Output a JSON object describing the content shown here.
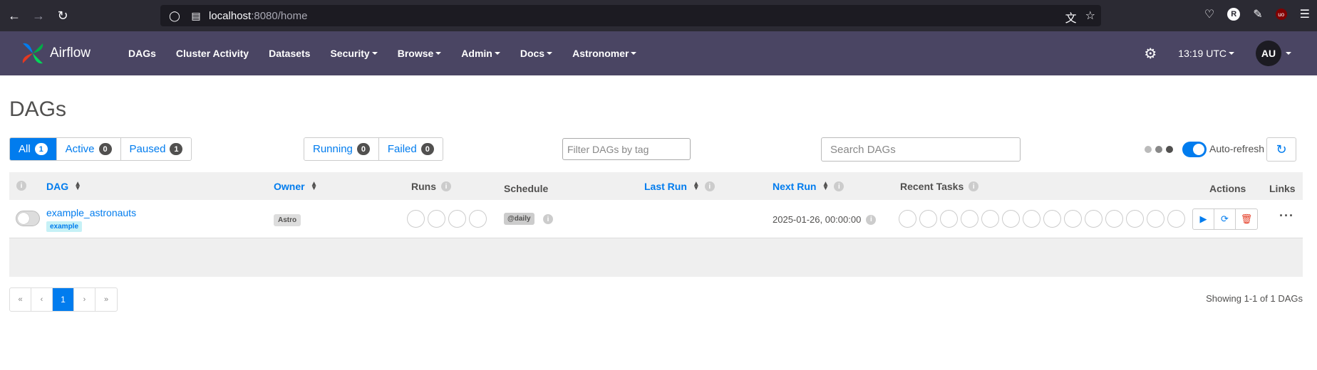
{
  "browser": {
    "url_host": "localhost",
    "url_rest": ":8080/home"
  },
  "navbar": {
    "brand": "Airflow",
    "items": [
      {
        "label": "DAGs",
        "dropdown": false
      },
      {
        "label": "Cluster Activity",
        "dropdown": false
      },
      {
        "label": "Datasets",
        "dropdown": false
      },
      {
        "label": "Security",
        "dropdown": true
      },
      {
        "label": "Browse",
        "dropdown": true
      },
      {
        "label": "Admin",
        "dropdown": true
      },
      {
        "label": "Docs",
        "dropdown": true
      },
      {
        "label": "Astronomer",
        "dropdown": true
      }
    ],
    "time": "13:19 UTC",
    "avatar": "AU"
  },
  "page": {
    "title": "DAGs"
  },
  "filters": {
    "status": [
      {
        "label": "All",
        "count": "1",
        "active": true
      },
      {
        "label": "Active",
        "count": "0",
        "active": false
      },
      {
        "label": "Paused",
        "count": "1",
        "active": false
      }
    ],
    "runs": [
      {
        "label": "Running",
        "count": "0"
      },
      {
        "label": "Failed",
        "count": "0"
      }
    ],
    "tag_placeholder": "Filter DAGs by tag",
    "search_placeholder": "Search DAGs",
    "autorefresh_label": "Auto-refresh"
  },
  "table": {
    "headers": {
      "dag": "DAG",
      "owner": "Owner",
      "runs": "Runs",
      "schedule": "Schedule",
      "last_run": "Last Run",
      "next_run": "Next Run",
      "recent_tasks": "Recent Tasks",
      "actions": "Actions",
      "links": "Links"
    },
    "rows": [
      {
        "dag_id": "example_astronauts",
        "tag": "example",
        "owner": "Astro",
        "schedule": "@daily",
        "last_run": "",
        "next_run": "2025-01-26, 00:00:00"
      }
    ]
  },
  "pagination": {
    "first": "«",
    "prev": "‹",
    "current": "1",
    "next": "›",
    "last": "»",
    "summary": "Showing 1-1 of 1 DAGs"
  }
}
